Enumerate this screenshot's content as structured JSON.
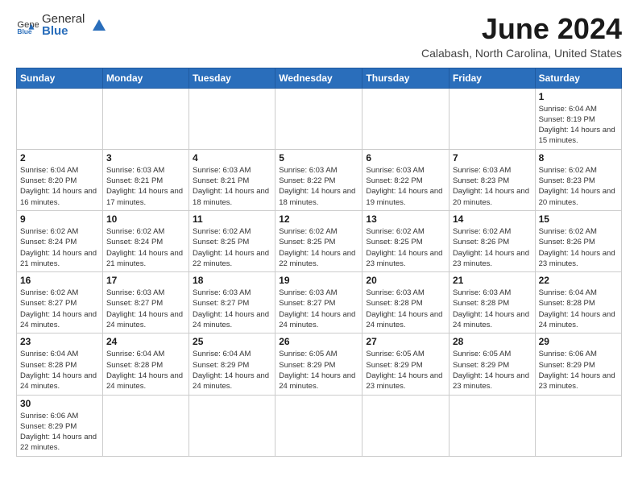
{
  "header": {
    "logo_general": "General",
    "logo_blue": "Blue",
    "month_title": "June 2024",
    "location": "Calabash, North Carolina, United States"
  },
  "weekdays": [
    "Sunday",
    "Monday",
    "Tuesday",
    "Wednesday",
    "Thursday",
    "Friday",
    "Saturday"
  ],
  "weeks": [
    [
      {
        "day": "",
        "info": ""
      },
      {
        "day": "",
        "info": ""
      },
      {
        "day": "",
        "info": ""
      },
      {
        "day": "",
        "info": ""
      },
      {
        "day": "",
        "info": ""
      },
      {
        "day": "",
        "info": ""
      },
      {
        "day": "1",
        "info": "Sunrise: 6:04 AM\nSunset: 8:19 PM\nDaylight: 14 hours and 15 minutes."
      }
    ],
    [
      {
        "day": "2",
        "info": "Sunrise: 6:04 AM\nSunset: 8:20 PM\nDaylight: 14 hours and 16 minutes."
      },
      {
        "day": "3",
        "info": "Sunrise: 6:03 AM\nSunset: 8:21 PM\nDaylight: 14 hours and 17 minutes."
      },
      {
        "day": "4",
        "info": "Sunrise: 6:03 AM\nSunset: 8:21 PM\nDaylight: 14 hours and 18 minutes."
      },
      {
        "day": "5",
        "info": "Sunrise: 6:03 AM\nSunset: 8:22 PM\nDaylight: 14 hours and 18 minutes."
      },
      {
        "day": "6",
        "info": "Sunrise: 6:03 AM\nSunset: 8:22 PM\nDaylight: 14 hours and 19 minutes."
      },
      {
        "day": "7",
        "info": "Sunrise: 6:03 AM\nSunset: 8:23 PM\nDaylight: 14 hours and 20 minutes."
      },
      {
        "day": "8",
        "info": "Sunrise: 6:02 AM\nSunset: 8:23 PM\nDaylight: 14 hours and 20 minutes."
      }
    ],
    [
      {
        "day": "9",
        "info": "Sunrise: 6:02 AM\nSunset: 8:24 PM\nDaylight: 14 hours and 21 minutes."
      },
      {
        "day": "10",
        "info": "Sunrise: 6:02 AM\nSunset: 8:24 PM\nDaylight: 14 hours and 21 minutes."
      },
      {
        "day": "11",
        "info": "Sunrise: 6:02 AM\nSunset: 8:25 PM\nDaylight: 14 hours and 22 minutes."
      },
      {
        "day": "12",
        "info": "Sunrise: 6:02 AM\nSunset: 8:25 PM\nDaylight: 14 hours and 22 minutes."
      },
      {
        "day": "13",
        "info": "Sunrise: 6:02 AM\nSunset: 8:25 PM\nDaylight: 14 hours and 23 minutes."
      },
      {
        "day": "14",
        "info": "Sunrise: 6:02 AM\nSunset: 8:26 PM\nDaylight: 14 hours and 23 minutes."
      },
      {
        "day": "15",
        "info": "Sunrise: 6:02 AM\nSunset: 8:26 PM\nDaylight: 14 hours and 23 minutes."
      }
    ],
    [
      {
        "day": "16",
        "info": "Sunrise: 6:02 AM\nSunset: 8:27 PM\nDaylight: 14 hours and 24 minutes."
      },
      {
        "day": "17",
        "info": "Sunrise: 6:03 AM\nSunset: 8:27 PM\nDaylight: 14 hours and 24 minutes."
      },
      {
        "day": "18",
        "info": "Sunrise: 6:03 AM\nSunset: 8:27 PM\nDaylight: 14 hours and 24 minutes."
      },
      {
        "day": "19",
        "info": "Sunrise: 6:03 AM\nSunset: 8:27 PM\nDaylight: 14 hours and 24 minutes."
      },
      {
        "day": "20",
        "info": "Sunrise: 6:03 AM\nSunset: 8:28 PM\nDaylight: 14 hours and 24 minutes."
      },
      {
        "day": "21",
        "info": "Sunrise: 6:03 AM\nSunset: 8:28 PM\nDaylight: 14 hours and 24 minutes."
      },
      {
        "day": "22",
        "info": "Sunrise: 6:04 AM\nSunset: 8:28 PM\nDaylight: 14 hours and 24 minutes."
      }
    ],
    [
      {
        "day": "23",
        "info": "Sunrise: 6:04 AM\nSunset: 8:28 PM\nDaylight: 14 hours and 24 minutes."
      },
      {
        "day": "24",
        "info": "Sunrise: 6:04 AM\nSunset: 8:28 PM\nDaylight: 14 hours and 24 minutes."
      },
      {
        "day": "25",
        "info": "Sunrise: 6:04 AM\nSunset: 8:29 PM\nDaylight: 14 hours and 24 minutes."
      },
      {
        "day": "26",
        "info": "Sunrise: 6:05 AM\nSunset: 8:29 PM\nDaylight: 14 hours and 24 minutes."
      },
      {
        "day": "27",
        "info": "Sunrise: 6:05 AM\nSunset: 8:29 PM\nDaylight: 14 hours and 23 minutes."
      },
      {
        "day": "28",
        "info": "Sunrise: 6:05 AM\nSunset: 8:29 PM\nDaylight: 14 hours and 23 minutes."
      },
      {
        "day": "29",
        "info": "Sunrise: 6:06 AM\nSunset: 8:29 PM\nDaylight: 14 hours and 23 minutes."
      }
    ],
    [
      {
        "day": "30",
        "info": "Sunrise: 6:06 AM\nSunset: 8:29 PM\nDaylight: 14 hours and 22 minutes."
      },
      {
        "day": "",
        "info": ""
      },
      {
        "day": "",
        "info": ""
      },
      {
        "day": "",
        "info": ""
      },
      {
        "day": "",
        "info": ""
      },
      {
        "day": "",
        "info": ""
      },
      {
        "day": "",
        "info": ""
      }
    ]
  ]
}
